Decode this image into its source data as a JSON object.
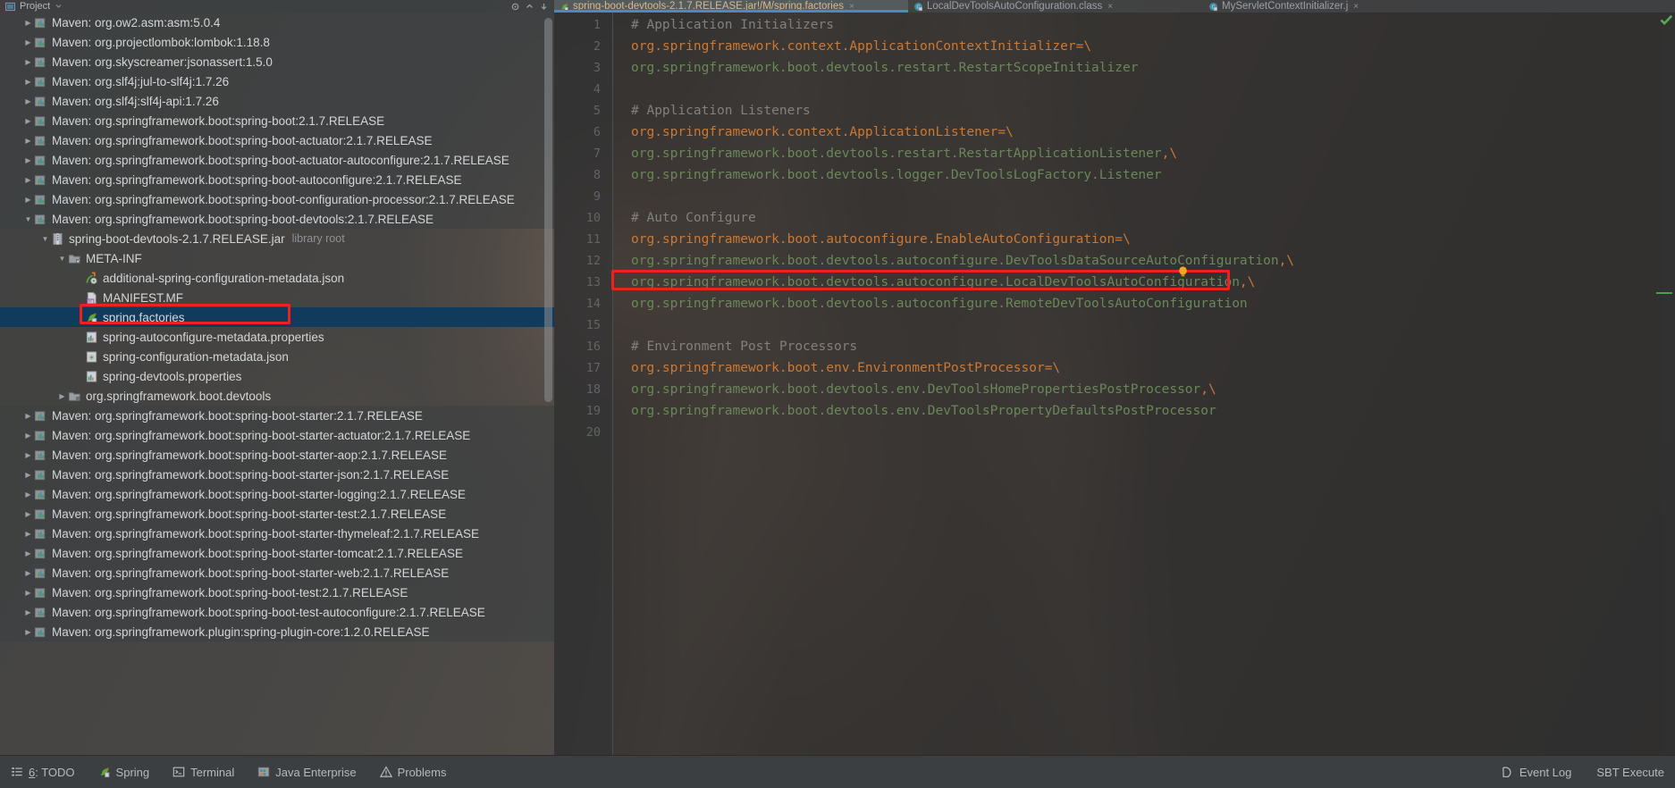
{
  "project_panel": {
    "title": "Project",
    "header_icons": [
      "project-view-icon",
      "chevron-down-icon",
      "collapse-all-icon",
      "settings-icon",
      "hide-icon"
    ],
    "tree": [
      {
        "label": "Maven: org.ow2.asm:asm:5.0.4",
        "icon": "maven-library-icon",
        "indent": 1,
        "arrow": "collapsed",
        "style": "dim"
      },
      {
        "label": "Maven: org.projectlombok:lombok:1.18.8",
        "icon": "maven-library-icon",
        "indent": 1,
        "arrow": "collapsed",
        "style": "dim"
      },
      {
        "label": "Maven: org.skyscreamer:jsonassert:1.5.0",
        "icon": "maven-library-icon",
        "indent": 1,
        "arrow": "collapsed",
        "style": "dim"
      },
      {
        "label": "Maven: org.slf4j:jul-to-slf4j:1.7.26",
        "icon": "maven-library-icon",
        "indent": 1,
        "arrow": "collapsed",
        "style": "dim"
      },
      {
        "label": "Maven: org.slf4j:slf4j-api:1.7.26",
        "icon": "maven-library-icon",
        "indent": 1,
        "arrow": "collapsed",
        "style": "dim"
      },
      {
        "label": "Maven: org.springframework.boot:spring-boot:2.1.7.RELEASE",
        "icon": "maven-library-icon",
        "indent": 1,
        "arrow": "collapsed",
        "style": "dim"
      },
      {
        "label": "Maven: org.springframework.boot:spring-boot-actuator:2.1.7.RELEASE",
        "icon": "maven-library-icon",
        "indent": 1,
        "arrow": "collapsed",
        "style": "dim"
      },
      {
        "label": "Maven: org.springframework.boot:spring-boot-actuator-autoconfigure:2.1.7.RELEASE",
        "icon": "maven-library-icon",
        "indent": 1,
        "arrow": "collapsed",
        "style": "dim"
      },
      {
        "label": "Maven: org.springframework.boot:spring-boot-autoconfigure:2.1.7.RELEASE",
        "icon": "maven-library-icon",
        "indent": 1,
        "arrow": "collapsed",
        "style": "dim"
      },
      {
        "label": "Maven: org.springframework.boot:spring-boot-configuration-processor:2.1.7.RELEASE",
        "icon": "maven-library-icon",
        "indent": 1,
        "arrow": "collapsed",
        "style": "dim"
      },
      {
        "label": "Maven: org.springframework.boot:spring-boot-devtools:2.1.7.RELEASE",
        "icon": "maven-library-icon",
        "indent": 1,
        "arrow": "expanded",
        "style": "dim"
      },
      {
        "label": "spring-boot-devtools-2.1.7.RELEASE.jar",
        "sub": "library root",
        "icon": "jar-icon",
        "indent": 2,
        "arrow": "expanded",
        "style": "jar"
      },
      {
        "label": "META-INF",
        "icon": "folder-icon",
        "indent": 3,
        "arrow": "expanded",
        "style": "jar"
      },
      {
        "label": "additional-spring-configuration-metadata.json",
        "icon": "spring-json-icon",
        "indent": 4,
        "arrow": "none",
        "style": "jar"
      },
      {
        "label": "MANIFEST.MF",
        "icon": "manifest-icon",
        "indent": 4,
        "arrow": "none",
        "style": "jar"
      },
      {
        "label": "spring.factories",
        "icon": "spring-leaf-icon",
        "indent": 4,
        "arrow": "none",
        "style": "selected"
      },
      {
        "label": "spring-autoconfigure-metadata.properties",
        "icon": "properties-icon",
        "indent": 4,
        "arrow": "none",
        "style": "jar"
      },
      {
        "label": "spring-configuration-metadata.json",
        "icon": "json-icon",
        "indent": 4,
        "arrow": "none",
        "style": "jar"
      },
      {
        "label": "spring-devtools.properties",
        "icon": "properties-icon",
        "indent": 4,
        "arrow": "none",
        "style": "jar"
      },
      {
        "label": "org.springframework.boot.devtools",
        "icon": "package-icon",
        "indent": 3,
        "arrow": "collapsed",
        "style": "jar"
      },
      {
        "label": "Maven: org.springframework.boot:spring-boot-starter:2.1.7.RELEASE",
        "icon": "maven-library-icon",
        "indent": 1,
        "arrow": "collapsed",
        "style": "dim"
      },
      {
        "label": "Maven: org.springframework.boot:spring-boot-starter-actuator:2.1.7.RELEASE",
        "icon": "maven-library-icon",
        "indent": 1,
        "arrow": "collapsed",
        "style": "dim"
      },
      {
        "label": "Maven: org.springframework.boot:spring-boot-starter-aop:2.1.7.RELEASE",
        "icon": "maven-library-icon",
        "indent": 1,
        "arrow": "collapsed",
        "style": "dim"
      },
      {
        "label": "Maven: org.springframework.boot:spring-boot-starter-json:2.1.7.RELEASE",
        "icon": "maven-library-icon",
        "indent": 1,
        "arrow": "collapsed",
        "style": "dim"
      },
      {
        "label": "Maven: org.springframework.boot:spring-boot-starter-logging:2.1.7.RELEASE",
        "icon": "maven-library-icon",
        "indent": 1,
        "arrow": "collapsed",
        "style": "dim"
      },
      {
        "label": "Maven: org.springframework.boot:spring-boot-starter-test:2.1.7.RELEASE",
        "icon": "maven-library-icon",
        "indent": 1,
        "arrow": "collapsed",
        "style": "dim"
      },
      {
        "label": "Maven: org.springframework.boot:spring-boot-starter-thymeleaf:2.1.7.RELEASE",
        "icon": "maven-library-icon",
        "indent": 1,
        "arrow": "collapsed",
        "style": "dim"
      },
      {
        "label": "Maven: org.springframework.boot:spring-boot-starter-tomcat:2.1.7.RELEASE",
        "icon": "maven-library-icon",
        "indent": 1,
        "arrow": "collapsed",
        "style": "dim"
      },
      {
        "label": "Maven: org.springframework.boot:spring-boot-starter-web:2.1.7.RELEASE",
        "icon": "maven-library-icon",
        "indent": 1,
        "arrow": "collapsed",
        "style": "dim"
      },
      {
        "label": "Maven: org.springframework.boot:spring-boot-test:2.1.7.RELEASE",
        "icon": "maven-library-icon",
        "indent": 1,
        "arrow": "collapsed",
        "style": "dim"
      },
      {
        "label": "Maven: org.springframework.boot:spring-boot-test-autoconfigure:2.1.7.RELEASE",
        "icon": "maven-library-icon",
        "indent": 1,
        "arrow": "collapsed",
        "style": "dim"
      },
      {
        "label": "Maven: org.springframework.plugin:spring-plugin-core:1.2.0.RELEASE",
        "icon": "maven-library-icon",
        "indent": 1,
        "arrow": "collapsed",
        "style": "dim"
      }
    ]
  },
  "editor_tabs": [
    {
      "label": "spring-boot-devtools-2.1.7.RELEASE.jar!/M/spring.factories",
      "icon": "spring-leaf-icon",
      "active": true
    },
    {
      "label": "LocalDevToolsAutoConfiguration.class",
      "icon": "class-icon",
      "active": false
    },
    {
      "label": "MyServletContextInitializer.j",
      "icon": "class-icon",
      "active": false
    }
  ],
  "editor": {
    "filetype": "properties",
    "inspection_status": "ok-check-icon",
    "cursor_line": 12,
    "highlighted_line": 13,
    "lines": [
      {
        "n": "1",
        "tokens": [
          {
            "t": "# Application Initializers",
            "c": "c-comment"
          }
        ]
      },
      {
        "n": "2",
        "tokens": [
          {
            "t": "org.springframework.context.ApplicationContextInitializer",
            "c": "c-key"
          },
          {
            "t": "=\\",
            "c": "c-sep"
          }
        ]
      },
      {
        "n": "3",
        "tokens": [
          {
            "t": "org.springframework.boot.devtools.restart.RestartScopeInitializer",
            "c": "c-val"
          }
        ]
      },
      {
        "n": "4",
        "tokens": []
      },
      {
        "n": "5",
        "tokens": [
          {
            "t": "# Application Listeners",
            "c": "c-comment"
          }
        ]
      },
      {
        "n": "6",
        "tokens": [
          {
            "t": "org.springframework.context.ApplicationListener",
            "c": "c-key"
          },
          {
            "t": "=\\",
            "c": "c-sep"
          }
        ]
      },
      {
        "n": "7",
        "tokens": [
          {
            "t": "org.springframework.boot.devtools.restart.RestartApplicationListener",
            "c": "c-val"
          },
          {
            "t": ",\\",
            "c": "c-sep"
          }
        ]
      },
      {
        "n": "8",
        "tokens": [
          {
            "t": "org.springframework.boot.devtools.logger.DevToolsLogFactory.Listener",
            "c": "c-val"
          }
        ]
      },
      {
        "n": "9",
        "tokens": []
      },
      {
        "n": "10",
        "tokens": [
          {
            "t": "# Auto Configure",
            "c": "c-comment"
          }
        ]
      },
      {
        "n": "11",
        "tokens": [
          {
            "t": "org.springframework.boot.autoconfigure.EnableAutoConfiguration",
            "c": "c-key"
          },
          {
            "t": "=\\",
            "c": "c-sep"
          }
        ]
      },
      {
        "n": "12",
        "tokens": [
          {
            "t": "org.springframework.boot.devtools.autoconfigure.DevToolsDataSourceAutoConfiguration",
            "c": "c-val"
          },
          {
            "t": ",\\",
            "c": "c-sep"
          }
        ]
      },
      {
        "n": "13",
        "tokens": [
          {
            "t": "org.springframework.boot.devtools.autoconfigure.LocalDevToolsAutoConfiguration",
            "c": "c-val"
          },
          {
            "t": ",\\",
            "c": "c-sep"
          }
        ]
      },
      {
        "n": "14",
        "tokens": [
          {
            "t": "org.springframework.boot.devtools.autoconfigure.RemoteDevToolsAutoConfiguration",
            "c": "c-val"
          }
        ]
      },
      {
        "n": "15",
        "tokens": []
      },
      {
        "n": "16",
        "tokens": [
          {
            "t": "# Environment Post Processors",
            "c": "c-comment"
          }
        ]
      },
      {
        "n": "17",
        "tokens": [
          {
            "t": "org.springframework.boot.env.EnvironmentPostProcessor",
            "c": "c-key"
          },
          {
            "t": "=\\",
            "c": "c-sep"
          }
        ]
      },
      {
        "n": "18",
        "tokens": [
          {
            "t": "org.springframework.boot.devtools.env.DevToolsHomePropertiesPostProcessor",
            "c": "c-val"
          },
          {
            "t": ",\\",
            "c": "c-sep"
          }
        ]
      },
      {
        "n": "19",
        "tokens": [
          {
            "t": "org.springframework.boot.devtools.env.DevToolsPropertyDefaultsPostProcessor",
            "c": "c-val"
          }
        ]
      },
      {
        "n": "20",
        "tokens": []
      }
    ]
  },
  "statusbar": {
    "left": [
      {
        "label": "6: TODO",
        "icon": "todo-icon"
      },
      {
        "label": "Spring",
        "icon": "spring-leaf-icon"
      },
      {
        "label": "Terminal",
        "icon": "terminal-icon"
      },
      {
        "label": "Java Enterprise",
        "icon": "java-enterprise-icon"
      },
      {
        "label": "Problems",
        "icon": "warning-triangle-icon"
      }
    ],
    "right": [
      {
        "label": "Event Log",
        "icon": "event-log-icon"
      },
      {
        "label": "SBT Execute",
        "icon": ""
      }
    ]
  },
  "annotations": {
    "color": "#f02020",
    "tree_target": "spring.factories",
    "code_target": "org.springframework.boot.devtools.autoconfigure.LocalDevToolsAutoConfiguration,\\"
  }
}
